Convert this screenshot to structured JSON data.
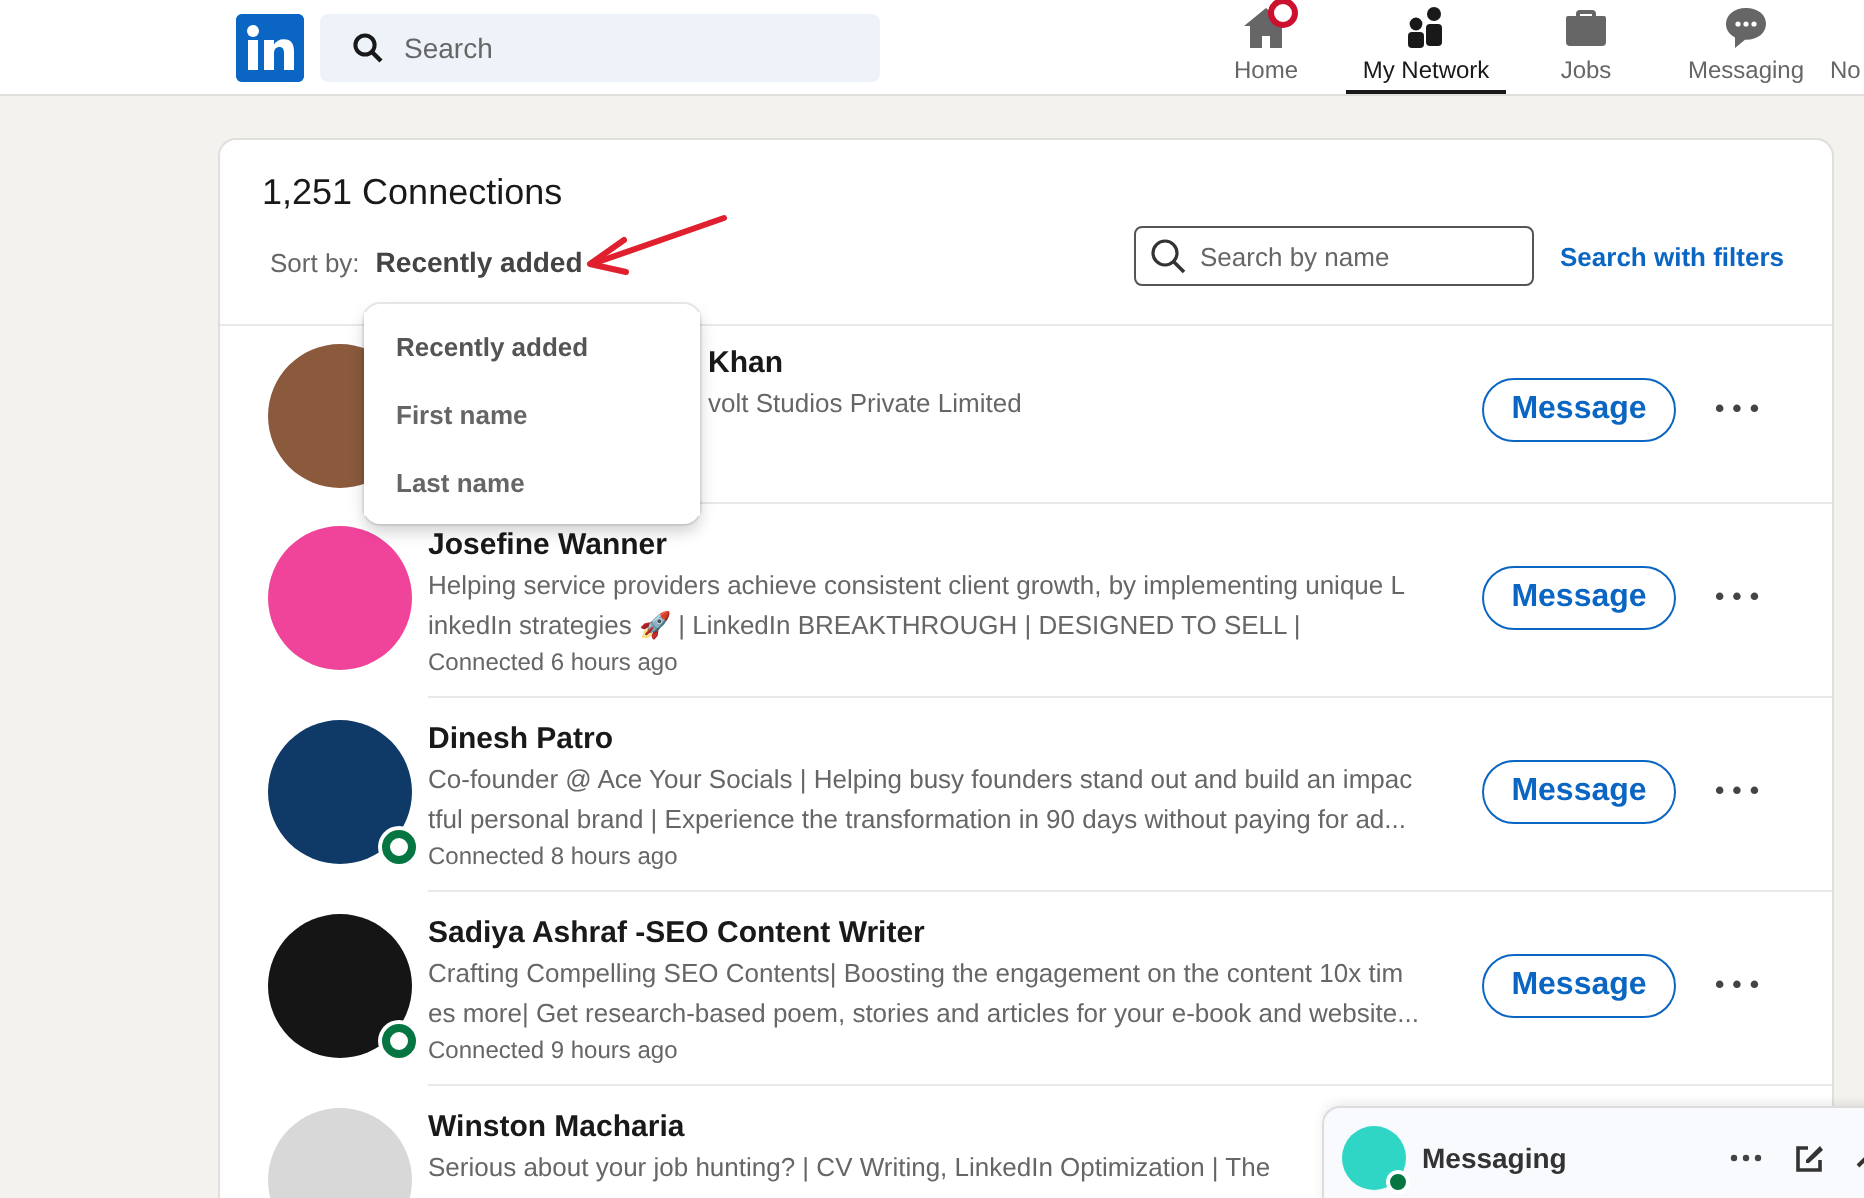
{
  "nav": {
    "search": {
      "placeholder": "Search"
    },
    "items": [
      {
        "label": "Home",
        "selected": false,
        "badge": true
      },
      {
        "label": "My Network",
        "selected": true,
        "badge": false
      },
      {
        "label": "Jobs",
        "selected": false,
        "badge": false
      },
      {
        "label": "Messaging",
        "selected": false,
        "badge": false
      },
      {
        "label": "No",
        "selected": false,
        "badge": false
      }
    ]
  },
  "connections": {
    "title": "1,251 Connections",
    "sort_label": "Sort by:",
    "sort_value": "Recently added",
    "search": {
      "placeholder": "Search by name"
    },
    "filters_link": "Search with filters",
    "sort_menu": {
      "expanded": true,
      "options": [
        {
          "label": "Recently added",
          "selected": true
        },
        {
          "label": "First name",
          "selected": false
        },
        {
          "label": "Last name",
          "selected": false
        }
      ]
    },
    "annotation": {
      "kind": "arrow"
    },
    "rows": [
      {
        "name": "Khan",
        "headline_lines": [
          "volt Studios Private Limited"
        ],
        "online": false,
        "action": "Message",
        "more": "•••"
      },
      {
        "name": "Josefine Wanner",
        "headline_lines": [
          "Helping service providers achieve consistent client growth, by implementing unique L",
          "inkedIn strategies 🚀 | LinkedIn BREAKTHROUGH | DESIGNED TO SELL |"
        ],
        "connected": "Connected 6 hours ago",
        "online": false,
        "action": "Message",
        "more": "•••"
      },
      {
        "name": "Dinesh Patro",
        "headline_lines": [
          "Co-founder @ Ace Your Socials | Helping busy founders stand out and build an impac",
          "tful personal brand | Experience the transformation in 90 days without paying for ad..."
        ],
        "connected": "Connected 8 hours ago",
        "online": true,
        "action": "Message",
        "more": "•••"
      },
      {
        "name": "Sadiya Ashraf -SEO Content Writer",
        "headline_lines": [
          "Crafting Compelling SEO Contents| Boosting the engagement on the content 10x tim",
          "es more| Get research-based poem, stories and articles for your e-book and website..."
        ],
        "connected": "Connected 9 hours ago",
        "online": true,
        "action": "Message",
        "more": "•••"
      },
      {
        "name": "Winston Macharia",
        "headline_lines": [
          "Serious about your job hunting? | CV Writing, LinkedIn Optimization | The"
        ],
        "online": false
      }
    ]
  },
  "messaging_bar": {
    "title": "Messaging",
    "online": true
  }
}
